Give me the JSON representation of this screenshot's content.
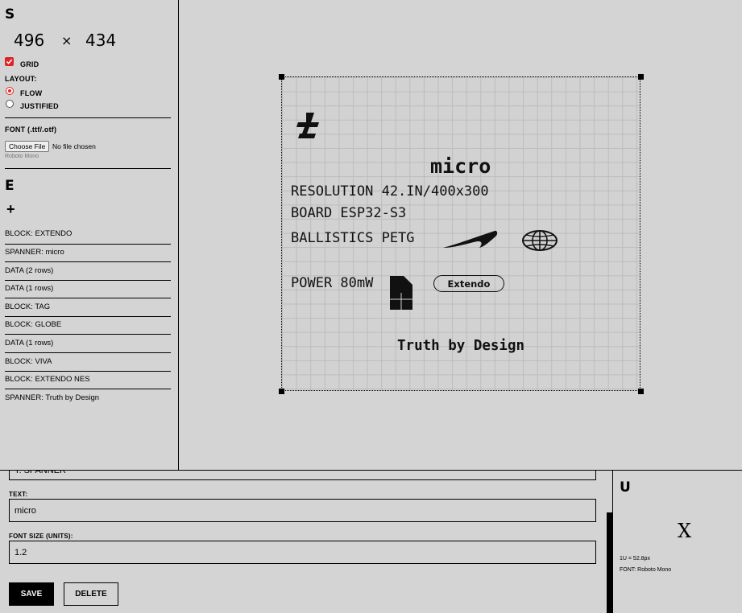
{
  "settings": {
    "title": "S",
    "width": "496",
    "times": "×",
    "height": "434",
    "grid_label": "GRID",
    "layout_label": "LAYOUT:",
    "layout_options": [
      "FLOW",
      "JUSTIFIED"
    ],
    "font_label": "FONT (.ttf/.otf)",
    "choose_file": "Choose File",
    "no_file": "No file chosen",
    "current_font": "Roboto Mono"
  },
  "elements": {
    "title": "E",
    "add": "+",
    "items": [
      "BLOCK: EXTENDO",
      "SPANNER: micro",
      "DATA (2 rows)",
      "DATA (1 rows)",
      "BLOCK: TAG",
      "BLOCK: GLOBE",
      "DATA (1 rows)",
      "BLOCK: VIVA",
      "BLOCK: EXTENDO NES",
      "SPANNER: Truth by Design"
    ]
  },
  "canvas": {
    "spanner_micro": "micro",
    "data_rows": [
      "RESOLUTION 42.IN/400x300",
      "BOARD ESP32-S3",
      "BALLISTICS PETG",
      "POWER 80mW"
    ],
    "badge": "Extendo",
    "spanner_truth": "Truth by Design"
  },
  "editor": {
    "type_partial": "T: SPANNER",
    "text_label": "TEXT:",
    "text_value": "micro",
    "font_size_label": "FONT SIZE (UNITS):",
    "font_size_value": "1.2",
    "save": "SAVE",
    "delete": "DELETE"
  },
  "units": {
    "title": "U",
    "close": "X",
    "unit_info": "1U = 52.8px",
    "font_info": "FONT: Roboto Mono"
  },
  "colors": {
    "accent": "#e02424",
    "background": "#d4d4d4",
    "ink": "#000000"
  }
}
